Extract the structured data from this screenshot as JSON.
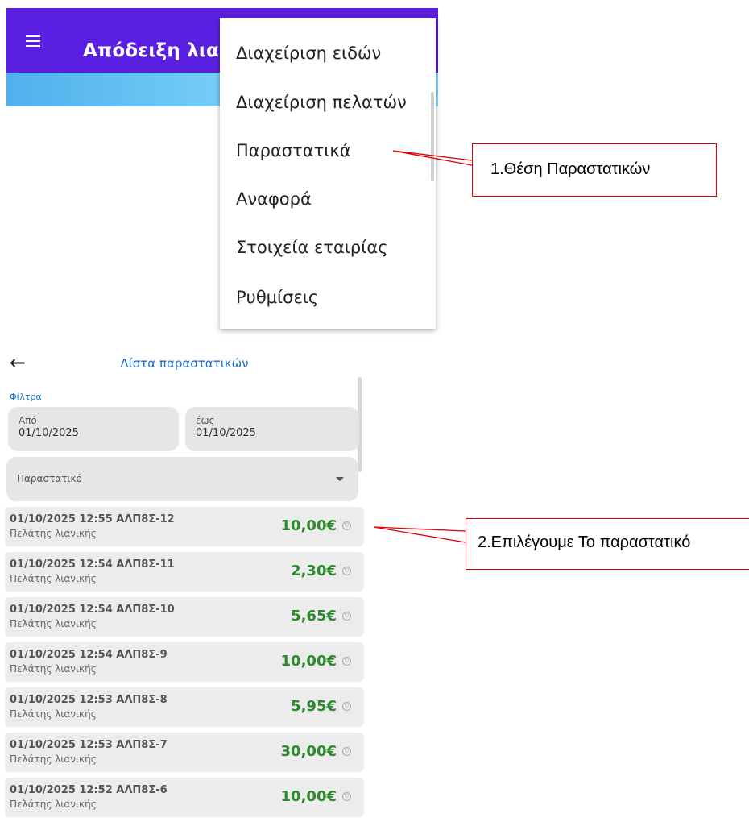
{
  "top_app": {
    "title": "Απόδειξη λια",
    "menu_items": [
      {
        "label": "Διαχείριση ειδών"
      },
      {
        "label": "Διαχείριση πελατών"
      },
      {
        "label": "Παραστατικά"
      },
      {
        "label": "Αναφορά"
      },
      {
        "label": "Στοιχεία εταιρίας"
      },
      {
        "label": "Ρυθμίσεις"
      }
    ],
    "colors": {
      "appbar": "#5a1fe0",
      "tab_strip": "#7dd3fa"
    }
  },
  "callouts": [
    {
      "text": "1.Θέση Παραστατικών"
    },
    {
      "text": "2.Επιλέγουμε Το παραστατικό"
    }
  ],
  "doc_list": {
    "title": "Λίστα παραστατικών",
    "back_icon": "arrow-left-icon",
    "filters_label": "Φίλτρα",
    "from_label": "Από",
    "from_value": "01/10/2025",
    "to_label": "έως",
    "to_value": "01/10/2025",
    "doc_type_placeholder": "Παραστατικό",
    "rows": [
      {
        "header": "01/10/2025 12:55  ΑΛΠ8Σ-12",
        "customer": "Πελάτης λιανικής",
        "amount": "10,00€"
      },
      {
        "header": "01/10/2025 12:54  ΑΛΠ8Σ-11",
        "customer": "Πελάτης λιανικής",
        "amount": "2,30€"
      },
      {
        "header": "01/10/2025 12:54  ΑΛΠ8Σ-10",
        "customer": "Πελάτης λιανικής",
        "amount": "5,65€"
      },
      {
        "header": "01/10/2025 12:54  ΑΛΠ8Σ-9",
        "customer": "Πελάτης λιανικής",
        "amount": "10,00€"
      },
      {
        "header": "01/10/2025 12:53  ΑΛΠ8Σ-8",
        "customer": "Πελάτης λιανικής",
        "amount": "5,95€"
      },
      {
        "header": "01/10/2025 12:53  ΑΛΠ8Σ-7",
        "customer": "Πελάτης λιανικής",
        "amount": "30,00€"
      },
      {
        "header": "01/10/2025 12:52  ΑΛΠ8Σ-6",
        "customer": "Πελάτης λιανικής",
        "amount": "10,00€"
      }
    ],
    "colors": {
      "title": "#1a6bd0",
      "amount": "#2d8a2d"
    }
  }
}
